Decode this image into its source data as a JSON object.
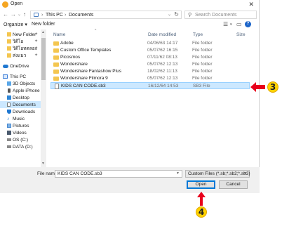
{
  "window": {
    "title": "Open",
    "close_glyph": "✕"
  },
  "nav": {
    "back": "←",
    "forward": "→",
    "dropdown": "⌄",
    "up": "↑",
    "breadcrumb": [
      "This PC",
      "Documents"
    ],
    "separator": "›",
    "search_placeholder": "Search Documents"
  },
  "toolbar": {
    "organize_label": "Organize ▾",
    "new_folder_label": "New folder",
    "help_glyph": "?"
  },
  "sidebar": {
    "items": [
      {
        "label": "New Folder",
        "pinned": true
      },
      {
        "label": "วิดีโอ",
        "pinned": true
      },
      {
        "label": "วิดีโอทดลอง",
        "pinned": true
      },
      {
        "label": "ส่งแมว",
        "pinned": true
      },
      {
        "label": "OneDrive"
      },
      {
        "label": "This PC"
      },
      {
        "label": "3D Objects"
      },
      {
        "label": "Apple iPhone"
      },
      {
        "label": "Desktop"
      },
      {
        "label": "Documents",
        "selected": true
      },
      {
        "label": "Downloads"
      },
      {
        "label": "Music"
      },
      {
        "label": "Pictures"
      },
      {
        "label": "Videos"
      },
      {
        "label": "OS (C:)"
      },
      {
        "label": "DATA (D:)"
      }
    ]
  },
  "columns": {
    "name": "Name",
    "date": "Date modified",
    "type": "Type",
    "size": "Size"
  },
  "files": [
    {
      "name": "Adobe",
      "date": "04/06/63 14:17",
      "type": "File folder",
      "kind": "folder"
    },
    {
      "name": "Custom Office Templates",
      "date": "05/07/62 16:15",
      "type": "File folder",
      "kind": "folder"
    },
    {
      "name": "Picosmos",
      "date": "07/11/62 08:13",
      "type": "File folder",
      "kind": "folder"
    },
    {
      "name": "Wondershare",
      "date": "05/07/62 12:13",
      "type": "File folder",
      "kind": "folder"
    },
    {
      "name": "Wondershare Fantashow Plus",
      "date": "18/02/62 11:13",
      "type": "File folder",
      "kind": "folder"
    },
    {
      "name": "Wondershare Filmora 9",
      "date": "05/07/62 12:13",
      "type": "File folder",
      "kind": "folder"
    },
    {
      "name": "KIDS CAN CODE.sb3",
      "date": "16/12/64 14:53",
      "type": "SB3 File",
      "kind": "file",
      "selected": true
    }
  ],
  "footer": {
    "filename_label": "File name:",
    "filename_value": "KIDS CAN CODE.sb3",
    "filter_value": "Custom Files (*.sb;*.sb2;*.sb3)",
    "open_label": "Open",
    "cancel_label": "Cancel"
  },
  "annotations": {
    "step3": "3",
    "step4": "4",
    "arrow_color": "#e8001c",
    "badge_color": "#ffd200"
  }
}
